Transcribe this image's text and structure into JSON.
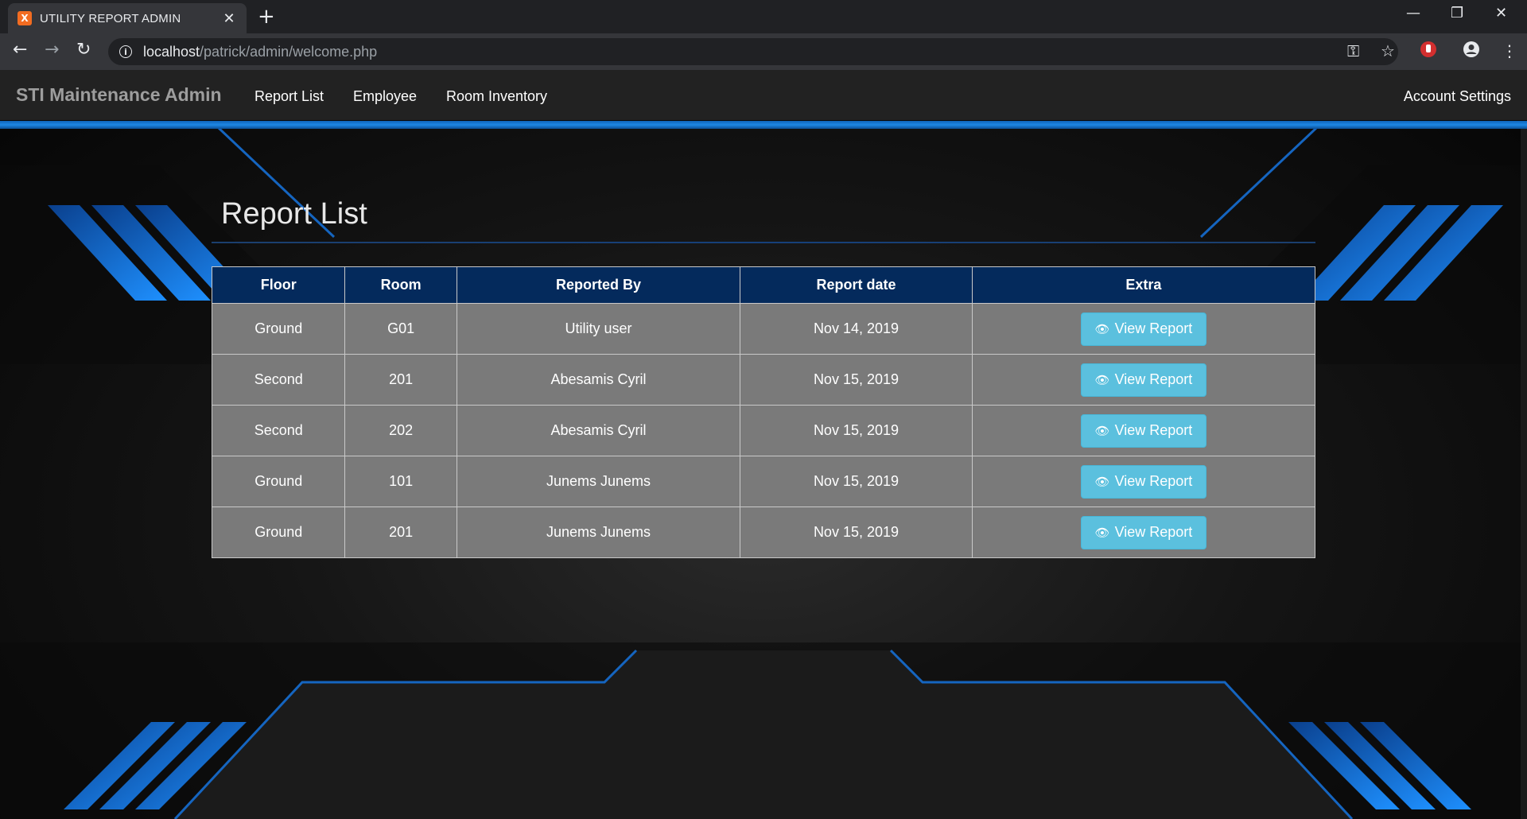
{
  "browser": {
    "tab_title": "UTILITY REPORT ADMIN",
    "favicon_text": "X",
    "url_host": "localhost",
    "url_path": "/patrick/admin/welcome.php"
  },
  "navbar": {
    "brand": "STI Maintenance Admin",
    "links": [
      "Report List",
      "Employee",
      "Room Inventory"
    ],
    "account": "Account Settings"
  },
  "main": {
    "heading": "Report List",
    "table": {
      "headers": [
        "Floor",
        "Room",
        "Reported By",
        "Report date",
        "Extra"
      ],
      "rows": [
        {
          "floor": "Ground",
          "room": "G01",
          "reported_by": "Utility user",
          "date": "Nov 14, 2019",
          "action": "View Report"
        },
        {
          "floor": "Second",
          "room": "201",
          "reported_by": "Abesamis Cyril",
          "date": "Nov 15, 2019",
          "action": "View Report"
        },
        {
          "floor": "Second",
          "room": "202",
          "reported_by": "Abesamis Cyril",
          "date": "Nov 15, 2019",
          "action": "View Report"
        },
        {
          "floor": "Ground",
          "room": "101",
          "reported_by": "Junems Junems",
          "date": "Nov 15, 2019",
          "action": "View Report"
        },
        {
          "floor": "Ground",
          "room": "201",
          "reported_by": "Junems Junems",
          "date": "Nov 15, 2019",
          "action": "View Report"
        }
      ]
    }
  },
  "colors": {
    "accent_blue": "#1e88e5",
    "table_header": "#042a5c",
    "table_cell": "#7a7a7a",
    "button_info": "#5bc0de"
  },
  "icons": [
    "info-icon",
    "back-arrow-icon",
    "forward-arrow-icon",
    "reload-icon",
    "key-icon",
    "star-icon",
    "extension-icon",
    "account-icon",
    "menu-icon",
    "eye-icon"
  ]
}
